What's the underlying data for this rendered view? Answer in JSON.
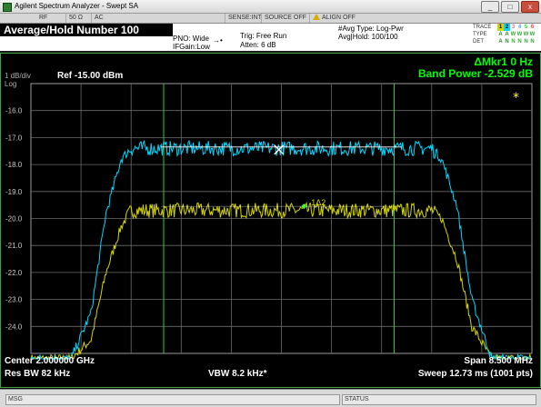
{
  "window": {
    "title": "Agilent Spectrum Analyzer - Swept SA",
    "min": "_",
    "max": "□",
    "close": "x"
  },
  "strip": {
    "rf": "RF",
    "ohm": "50 Ω",
    "ac": "AC",
    "sense": "SENSE:INT",
    "source": "SOURCE OFF",
    "align": "ALIGN OFF"
  },
  "header": {
    "measurement": "Average/Hold Number 100",
    "pno": "PNO: Wide",
    "ifgain": "IFGain:Low",
    "trig": "Trig: Free Run",
    "atten": "Atten: 6 dB",
    "avg_type": "#Avg Type: Log-Pwr",
    "avg_hold": "Avg|Hold: 100/100"
  },
  "trace_table": {
    "trace_label": "TRACE",
    "type_label": "TYPE",
    "det_label": "DET",
    "trace": [
      "1",
      "2",
      "3",
      "4",
      "5",
      "6"
    ],
    "type": [
      "A",
      "A",
      "W",
      "W",
      "W",
      "W"
    ],
    "det": [
      "A",
      "N",
      "N",
      "N",
      "N",
      "N"
    ],
    "trace_colors": [
      "#d4d400",
      "#00d8ff",
      "#ff60a0",
      "#3ba3ff",
      "#00ff00",
      "#ff3b3b"
    ]
  },
  "plot": {
    "scale": "1 dB/div",
    "log": "Log",
    "ref": "Ref -15.00 dBm",
    "marker_readout": "ΔMkr1 0 Hz",
    "band_power": "Band Power -2.529 dB",
    "star": "*",
    "marker_label": "1Δ2",
    "y_ticks": [
      "-16.0",
      "-17.0",
      "-18.0",
      "-19.0",
      "-20.0",
      "-21.0",
      "-22.0",
      "-23.0",
      "-24.0"
    ],
    "center": "Center 2.000000 GHz",
    "span": "Span 8.500 MHz",
    "res_bw": "Res BW 82 kHz",
    "vbw": "VBW 8.2 kHz*",
    "sweep": "Sweep  12.73 ms (1001 pts)"
  },
  "status": {
    "msg_label": "MSG",
    "status_label": "STATUS"
  },
  "chart_data": {
    "type": "line",
    "ylim": [
      -25,
      -15
    ],
    "y_unit": "dBm",
    "x_center_ghz": 2.0,
    "x_span_mhz": 8.5,
    "series": [
      {
        "trace": "1",
        "color": "#d4d400",
        "plateau_dbm": -19.7,
        "shape_x": [
          0.0,
          0.08,
          0.12,
          0.15,
          0.18,
          0.2,
          0.8,
          0.82,
          0.85,
          0.88,
          0.92,
          1.0
        ],
        "shape_y": [
          -25.2,
          -25.2,
          -24.5,
          -22.0,
          -20.3,
          -19.7,
          -19.7,
          -20.0,
          -21.5,
          -24.0,
          -25.2,
          -25.2
        ]
      },
      {
        "trace": "2",
        "color": "#00d8ff",
        "plateau_dbm": -17.4,
        "shape_x": [
          0.0,
          0.08,
          0.12,
          0.15,
          0.18,
          0.2,
          0.8,
          0.82,
          0.85,
          0.88,
          0.92,
          1.0
        ],
        "shape_y": [
          -25.2,
          -25.2,
          -23.5,
          -19.8,
          -17.8,
          -17.4,
          -17.4,
          -17.8,
          -19.5,
          -23.0,
          -25.2,
          -25.2
        ]
      }
    ]
  }
}
